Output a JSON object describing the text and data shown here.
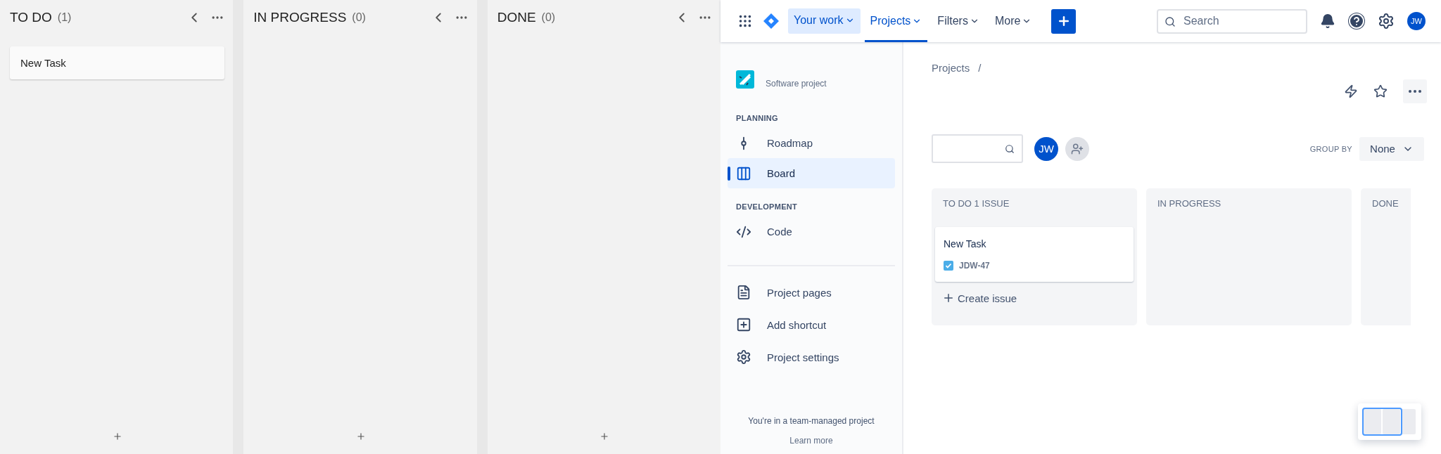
{
  "left_board": {
    "columns": [
      {
        "title": "TO DO",
        "count": "(1)",
        "cards": [
          "New Task"
        ]
      },
      {
        "title": "IN PROGRESS",
        "count": "(0)"
      },
      {
        "title": "DONE",
        "count": "(0)"
      }
    ]
  },
  "top_nav": {
    "items": [
      {
        "label": "Your work",
        "selected": false,
        "highlighted": true
      },
      {
        "label": "Projects",
        "selected": true,
        "highlighted": false
      },
      {
        "label": "Filters",
        "selected": false,
        "highlighted": false
      },
      {
        "label": "More",
        "selected": false,
        "highlighted": false
      }
    ],
    "search": {
      "placeholder": "Search"
    },
    "avatar": "JW"
  },
  "sidebar": {
    "project_type": "Software project",
    "sections": [
      {
        "heading": "PLANNING",
        "items": [
          {
            "label": "Roadmap",
            "selected": false
          },
          {
            "label": "Board",
            "selected": true
          }
        ]
      },
      {
        "heading": "DEVELOPMENT",
        "items": [
          {
            "label": "Code",
            "selected": false
          }
        ]
      }
    ],
    "links": [
      "Project pages",
      "Add shortcut",
      "Project settings"
    ],
    "footer": "You're in a team-managed project",
    "learn_more": "Learn more"
  },
  "main": {
    "breadcrumb": "Projects",
    "separator": "/",
    "avatar": "JW",
    "group_by": {
      "label": "GROUP BY",
      "value": "None"
    },
    "columns": [
      {
        "title": "TO DO 1 ISSUE",
        "cards": [
          {
            "title": "New Task",
            "key": "JDW-47"
          }
        ],
        "create": "Create issue"
      },
      {
        "title": "IN PROGRESS"
      },
      {
        "title": "DONE"
      }
    ]
  }
}
